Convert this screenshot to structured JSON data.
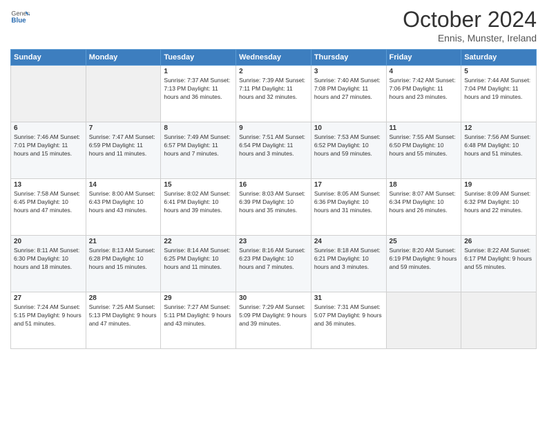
{
  "header": {
    "logo_general": "General",
    "logo_blue": "Blue",
    "title": "October 2024",
    "location": "Ennis, Munster, Ireland"
  },
  "days_of_week": [
    "Sunday",
    "Monday",
    "Tuesday",
    "Wednesday",
    "Thursday",
    "Friday",
    "Saturday"
  ],
  "weeks": [
    [
      {
        "day": "",
        "info": ""
      },
      {
        "day": "",
        "info": ""
      },
      {
        "day": "1",
        "info": "Sunrise: 7:37 AM\nSunset: 7:13 PM\nDaylight: 11 hours and 36 minutes."
      },
      {
        "day": "2",
        "info": "Sunrise: 7:39 AM\nSunset: 7:11 PM\nDaylight: 11 hours and 32 minutes."
      },
      {
        "day": "3",
        "info": "Sunrise: 7:40 AM\nSunset: 7:08 PM\nDaylight: 11 hours and 27 minutes."
      },
      {
        "day": "4",
        "info": "Sunrise: 7:42 AM\nSunset: 7:06 PM\nDaylight: 11 hours and 23 minutes."
      },
      {
        "day": "5",
        "info": "Sunrise: 7:44 AM\nSunset: 7:04 PM\nDaylight: 11 hours and 19 minutes."
      }
    ],
    [
      {
        "day": "6",
        "info": "Sunrise: 7:46 AM\nSunset: 7:01 PM\nDaylight: 11 hours and 15 minutes."
      },
      {
        "day": "7",
        "info": "Sunrise: 7:47 AM\nSunset: 6:59 PM\nDaylight: 11 hours and 11 minutes."
      },
      {
        "day": "8",
        "info": "Sunrise: 7:49 AM\nSunset: 6:57 PM\nDaylight: 11 hours and 7 minutes."
      },
      {
        "day": "9",
        "info": "Sunrise: 7:51 AM\nSunset: 6:54 PM\nDaylight: 11 hours and 3 minutes."
      },
      {
        "day": "10",
        "info": "Sunrise: 7:53 AM\nSunset: 6:52 PM\nDaylight: 10 hours and 59 minutes."
      },
      {
        "day": "11",
        "info": "Sunrise: 7:55 AM\nSunset: 6:50 PM\nDaylight: 10 hours and 55 minutes."
      },
      {
        "day": "12",
        "info": "Sunrise: 7:56 AM\nSunset: 6:48 PM\nDaylight: 10 hours and 51 minutes."
      }
    ],
    [
      {
        "day": "13",
        "info": "Sunrise: 7:58 AM\nSunset: 6:45 PM\nDaylight: 10 hours and 47 minutes."
      },
      {
        "day": "14",
        "info": "Sunrise: 8:00 AM\nSunset: 6:43 PM\nDaylight: 10 hours and 43 minutes."
      },
      {
        "day": "15",
        "info": "Sunrise: 8:02 AM\nSunset: 6:41 PM\nDaylight: 10 hours and 39 minutes."
      },
      {
        "day": "16",
        "info": "Sunrise: 8:03 AM\nSunset: 6:39 PM\nDaylight: 10 hours and 35 minutes."
      },
      {
        "day": "17",
        "info": "Sunrise: 8:05 AM\nSunset: 6:36 PM\nDaylight: 10 hours and 31 minutes."
      },
      {
        "day": "18",
        "info": "Sunrise: 8:07 AM\nSunset: 6:34 PM\nDaylight: 10 hours and 26 minutes."
      },
      {
        "day": "19",
        "info": "Sunrise: 8:09 AM\nSunset: 6:32 PM\nDaylight: 10 hours and 22 minutes."
      }
    ],
    [
      {
        "day": "20",
        "info": "Sunrise: 8:11 AM\nSunset: 6:30 PM\nDaylight: 10 hours and 18 minutes."
      },
      {
        "day": "21",
        "info": "Sunrise: 8:13 AM\nSunset: 6:28 PM\nDaylight: 10 hours and 15 minutes."
      },
      {
        "day": "22",
        "info": "Sunrise: 8:14 AM\nSunset: 6:25 PM\nDaylight: 10 hours and 11 minutes."
      },
      {
        "day": "23",
        "info": "Sunrise: 8:16 AM\nSunset: 6:23 PM\nDaylight: 10 hours and 7 minutes."
      },
      {
        "day": "24",
        "info": "Sunrise: 8:18 AM\nSunset: 6:21 PM\nDaylight: 10 hours and 3 minutes."
      },
      {
        "day": "25",
        "info": "Sunrise: 8:20 AM\nSunset: 6:19 PM\nDaylight: 9 hours and 59 minutes."
      },
      {
        "day": "26",
        "info": "Sunrise: 8:22 AM\nSunset: 6:17 PM\nDaylight: 9 hours and 55 minutes."
      }
    ],
    [
      {
        "day": "27",
        "info": "Sunrise: 7:24 AM\nSunset: 5:15 PM\nDaylight: 9 hours and 51 minutes."
      },
      {
        "day": "28",
        "info": "Sunrise: 7:25 AM\nSunset: 5:13 PM\nDaylight: 9 hours and 47 minutes."
      },
      {
        "day": "29",
        "info": "Sunrise: 7:27 AM\nSunset: 5:11 PM\nDaylight: 9 hours and 43 minutes."
      },
      {
        "day": "30",
        "info": "Sunrise: 7:29 AM\nSunset: 5:09 PM\nDaylight: 9 hours and 39 minutes."
      },
      {
        "day": "31",
        "info": "Sunrise: 7:31 AM\nSunset: 5:07 PM\nDaylight: 9 hours and 36 minutes."
      },
      {
        "day": "",
        "info": ""
      },
      {
        "day": "",
        "info": ""
      }
    ]
  ]
}
